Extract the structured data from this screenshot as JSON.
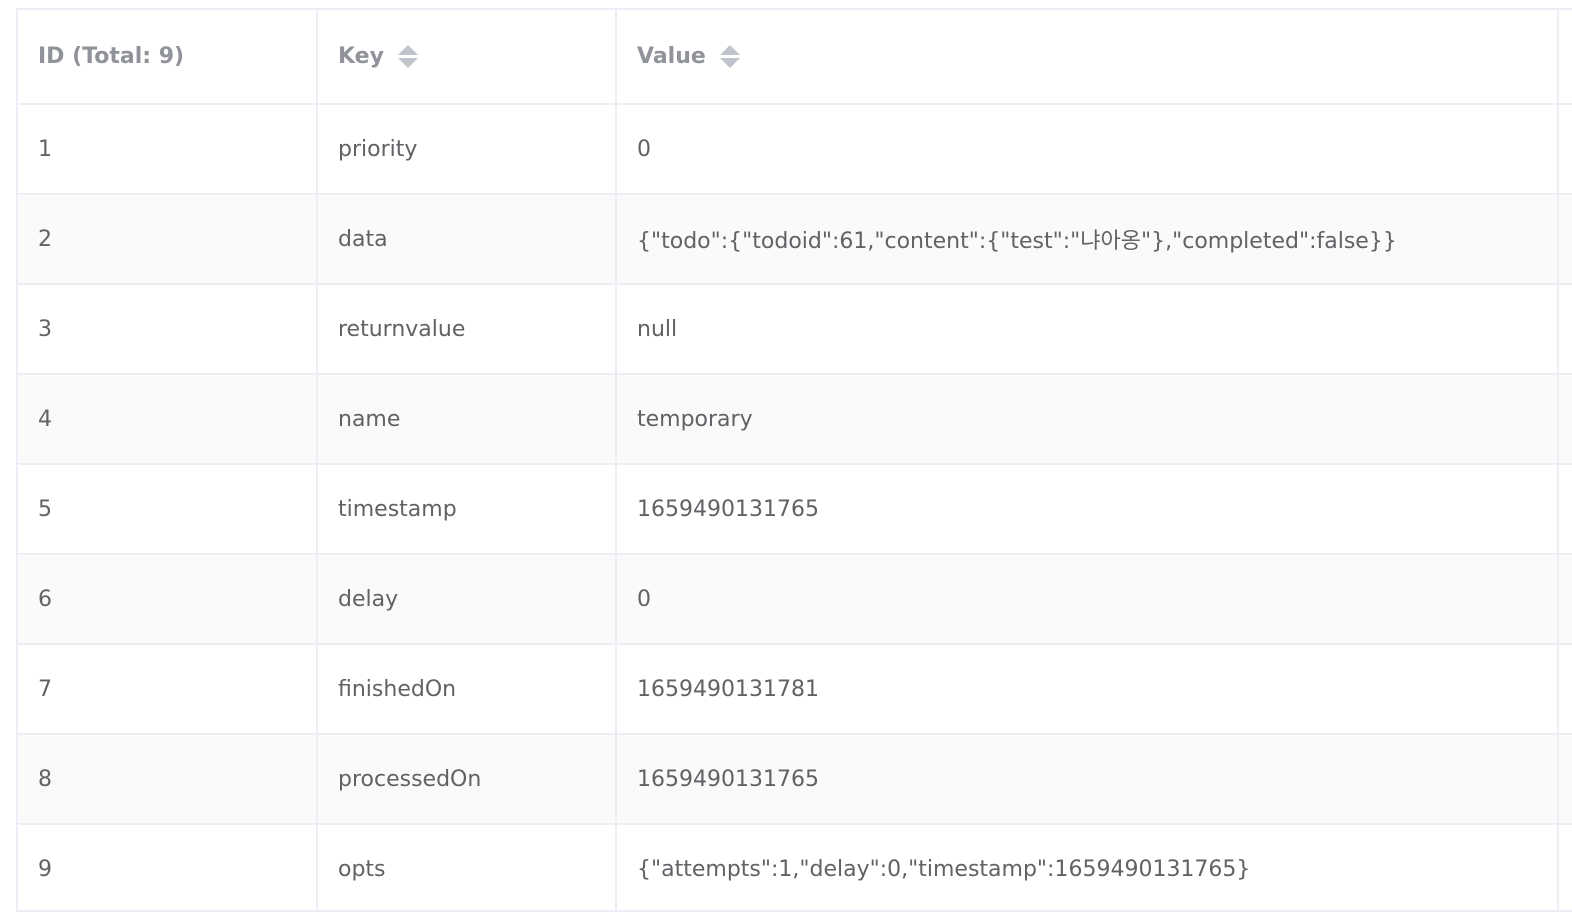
{
  "table": {
    "headers": {
      "id": "ID (Total: 9)",
      "key": "Key",
      "value": "Value"
    },
    "rows": [
      {
        "id": "1",
        "key": "priority",
        "value": "0"
      },
      {
        "id": "2",
        "key": "data",
        "value": "{\"todo\":{\"todoid\":61,\"content\":{\"test\":\"냐아옹\"},\"completed\":false}}"
      },
      {
        "id": "3",
        "key": "returnvalue",
        "value": "null"
      },
      {
        "id": "4",
        "key": "name",
        "value": "temporary"
      },
      {
        "id": "5",
        "key": "timestamp",
        "value": "1659490131765"
      },
      {
        "id": "6",
        "key": "delay",
        "value": "0"
      },
      {
        "id": "7",
        "key": "finishedOn",
        "value": "1659490131781"
      },
      {
        "id": "8",
        "key": "processedOn",
        "value": "1659490131765"
      },
      {
        "id": "9",
        "key": "opts",
        "value": "{\"attempts\":1,\"delay\":0,\"timestamp\":1659490131765}"
      }
    ]
  },
  "icons": {
    "sort": "sort-caret-icon"
  },
  "colors": {
    "header_text": "#909399",
    "cell_text": "#606266",
    "border": "#ebeef5",
    "stripe": "#fafafa"
  }
}
